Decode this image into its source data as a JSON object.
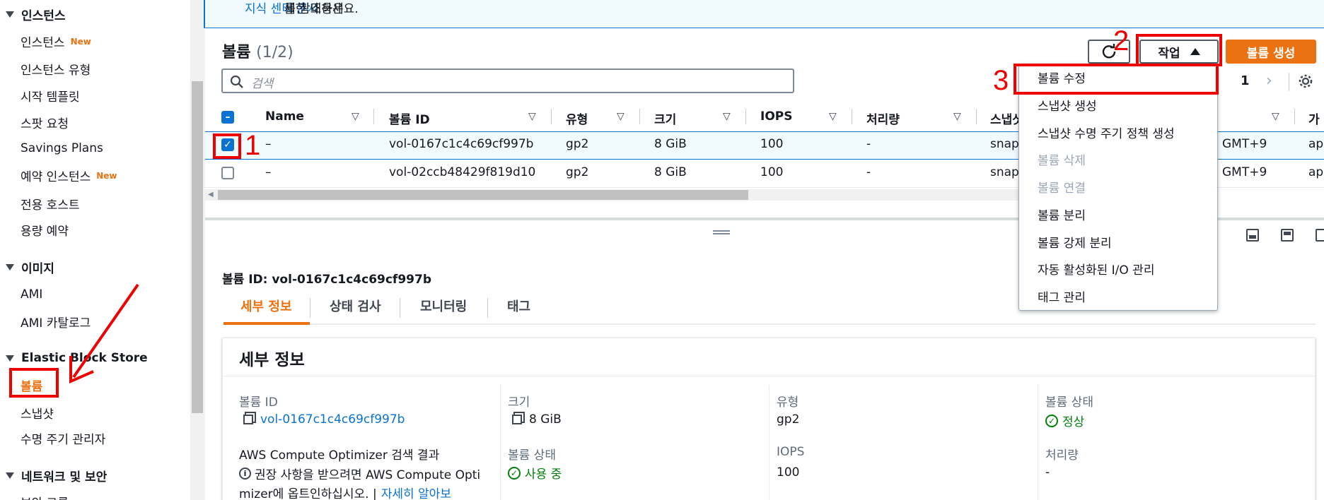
{
  "sidebar": {
    "sections": [
      {
        "label": "인스턴스",
        "items": [
          {
            "label": "인스턴스",
            "badge": "New"
          },
          {
            "label": "인스턴스 유형"
          },
          {
            "label": "시작 템플릿"
          },
          {
            "label": "스팟 요청"
          },
          {
            "label": "Savings Plans"
          },
          {
            "label": "예약 인스턴스",
            "badge": "New"
          },
          {
            "label": "전용 호스트"
          },
          {
            "label": "용량 예약"
          }
        ]
      },
      {
        "label": "이미지",
        "items": [
          {
            "label": "AMI"
          },
          {
            "label": "AMI 카탈로그"
          }
        ]
      },
      {
        "label": "Elastic Block Store",
        "items": [
          {
            "label": "볼륨"
          },
          {
            "label": "스냅샷"
          },
          {
            "label": "수명 주기 관리자"
          }
        ]
      },
      {
        "label": "네트워크 및 보안",
        "items": [
          {
            "label": "보안 그룹"
          }
        ]
      }
    ]
  },
  "banner": {
    "prefix": "세한 내용은 ",
    "link": "지식 센터 문서",
    "suffix": "를 참조하세요."
  },
  "volumes": {
    "title": "볼륨",
    "count": "(1/2)",
    "actions_label": "작업",
    "create_label": "볼륨 생성",
    "search_placeholder": "검색",
    "page": "1",
    "columns": [
      "Name",
      "볼륨 ID",
      "유형",
      "크기",
      "IOPS",
      "처리량",
      "스냅샷",
      "가"
    ],
    "rows": [
      {
        "name": "–",
        "id": "vol-0167c1c4c69cf997b",
        "type": "gp2",
        "size": "8 GiB",
        "iops": "100",
        "throughput": "-",
        "snapshot": "snap",
        "created": "GMT+9",
        "az": "ap-",
        "selected": true
      },
      {
        "name": "–",
        "id": "vol-02ccb48429f819d10",
        "type": "gp2",
        "size": "8 GiB",
        "iops": "100",
        "throughput": "-",
        "snapshot": "snap",
        "created": "GMT+9",
        "az": "ap-",
        "selected": false
      }
    ]
  },
  "actions_menu": [
    {
      "label": "볼륨 수정",
      "disabled": false
    },
    {
      "label": "스냅샷 생성",
      "disabled": false
    },
    {
      "label": "스냅샷 수명 주기 정책 생성",
      "disabled": false
    },
    {
      "label": "볼륨 삭제",
      "disabled": true
    },
    {
      "label": "볼륨 연결",
      "disabled": true
    },
    {
      "label": "볼륨 분리",
      "disabled": false
    },
    {
      "label": "볼륨 강제 분리",
      "disabled": false
    },
    {
      "label": "자동 활성화된 I/O 관리",
      "disabled": false
    },
    {
      "label": "태그 관리",
      "disabled": false
    }
  ],
  "details": {
    "heading": "볼륨 ID: vol-0167c1c4c69cf997b",
    "tabs": [
      "세부 정보",
      "상태 검사",
      "모니터링",
      "태그"
    ],
    "card_title": "세부 정보",
    "fields": {
      "volume_id_label": "볼륨 ID",
      "volume_id": "vol-0167c1c4c69cf997b",
      "size_label": "크기",
      "size": "8 GiB",
      "type_label": "유형",
      "type": "gp2",
      "vol_status_label": "볼륨 상태",
      "vol_status": "정상",
      "optimizer_label": "AWS Compute Optimizer 검색 결과",
      "optimizer_text_1": "권장 사항을 받으려면 AWS Compute Opti",
      "optimizer_text_2": "mizer에 옵트인하십시오. |",
      "optimizer_link": "자세히 알아보",
      "state_label": "볼륨 상태",
      "state": "사용 중",
      "iops_label": "IOPS",
      "iops": "100",
      "throughput_label": "처리량",
      "throughput": "-"
    }
  },
  "annotations": [
    "1",
    "2",
    "3"
  ],
  "colors": {
    "accent": "#ec7211",
    "link": "#0972d3",
    "annotation": "#e00000",
    "success": "#037f0c"
  }
}
